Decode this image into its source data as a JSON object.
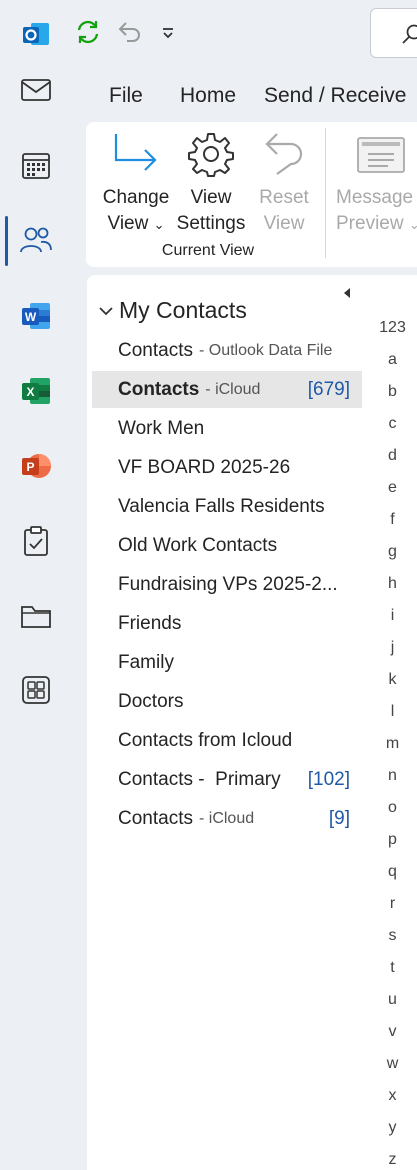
{
  "menu": {
    "tabs": [
      "File",
      "Home",
      "Send / Receive"
    ]
  },
  "ribbon": {
    "change_view": "Change",
    "change_view2": "View",
    "view_settings": "View",
    "view_settings2": "Settings",
    "reset_view": "Reset",
    "reset_view2": "View",
    "message_preview": "Message",
    "message_preview2": "Preview",
    "group_label": "Current View"
  },
  "folders": {
    "section_title": "My Contacts",
    "items": [
      {
        "name": "Contacts",
        "sub": "- Outlook Data File",
        "count": ""
      },
      {
        "name": "Contacts",
        "sub": "- iCloud",
        "count": "[679]"
      },
      {
        "name": "Work Men",
        "sub": "",
        "count": ""
      },
      {
        "name": "VF BOARD 2025-26",
        "sub": "",
        "count": ""
      },
      {
        "name": "Valencia Falls Residents",
        "sub": "",
        "count": ""
      },
      {
        "name": "Old Work Contacts",
        "sub": "",
        "count": ""
      },
      {
        "name": "Fundraising VPs 2025-2...",
        "sub": "",
        "count": ""
      },
      {
        "name": "Friends",
        "sub": "",
        "count": ""
      },
      {
        "name": "Family",
        "sub": "",
        "count": ""
      },
      {
        "name": "Doctors",
        "sub": "",
        "count": ""
      },
      {
        "name": "Contacts from Icloud",
        "sub": "",
        "count": ""
      },
      {
        "name": "Contacts -  Primary",
        "sub": "",
        "count": "[102]"
      },
      {
        "name": "Contacts",
        "sub": "- iCloud",
        "count": "[9]"
      }
    ]
  },
  "alphabet": [
    "123",
    "a",
    "b",
    "c",
    "d",
    "e",
    "f",
    "g",
    "h",
    "i",
    "j",
    "k",
    "l",
    "m",
    "n",
    "o",
    "p",
    "q",
    "r",
    "s",
    "t",
    "u",
    "v",
    "w",
    "x",
    "y",
    "z"
  ],
  "colors": {
    "accent": "#1f5aa6",
    "rail_bg": "#eceff3",
    "selected_bg": "#e6e6e6"
  }
}
